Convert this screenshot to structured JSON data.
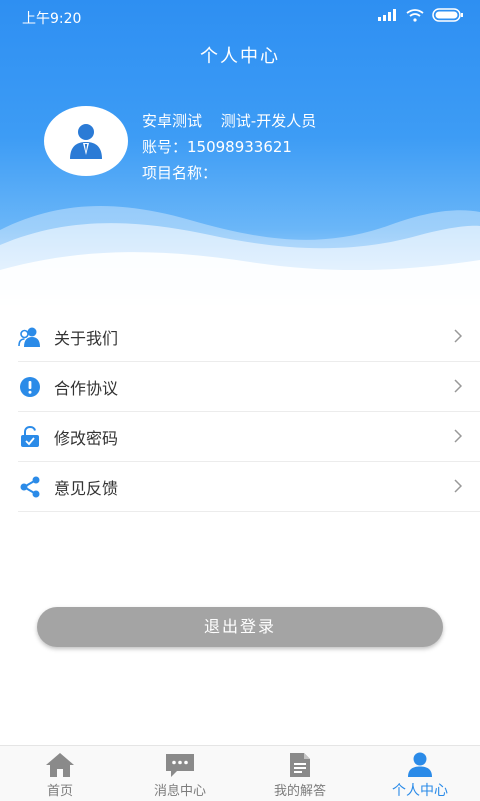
{
  "status_bar": {
    "time": "上午9:20"
  },
  "header": {
    "title": "个人中心"
  },
  "profile": {
    "name": "安卓测试",
    "role": "测试-开发人员",
    "account": "账号：15098933621",
    "project": "项目名称："
  },
  "menu": [
    {
      "label": "关于我们",
      "icon": "users-icon"
    },
    {
      "label": "合作协议",
      "icon": "exclamation-icon"
    },
    {
      "label": "修改密码",
      "icon": "lock-icon"
    },
    {
      "label": "意见反馈",
      "icon": "share-icon"
    }
  ],
  "logout_label": "退出登录",
  "tabs": [
    {
      "label": "首页",
      "icon": "home-icon"
    },
    {
      "label": "消息中心",
      "icon": "message-icon"
    },
    {
      "label": "我的解答",
      "icon": "document-icon"
    },
    {
      "label": "个人中心",
      "icon": "person-icon",
      "active": true
    }
  ],
  "colors": {
    "header_blue": "#2e8ff2",
    "accent_blue": "#2b8be8",
    "logout_gray": "#a4a4a4",
    "tab_inactive": "#7c7c7c"
  }
}
